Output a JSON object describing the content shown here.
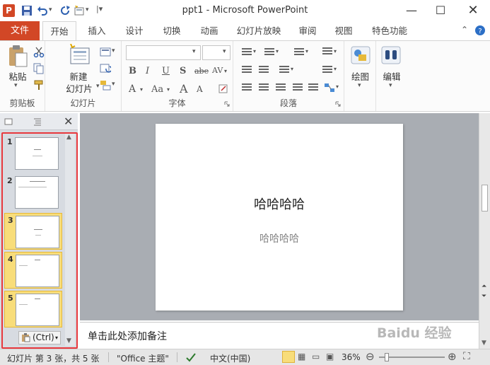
{
  "window": {
    "title": "ppt1 - Microsoft PowerPoint",
    "app_logo": "P",
    "controls": [
      "minimize-icon",
      "maximize-icon",
      "close-icon"
    ]
  },
  "quick_access": [
    "save-icon",
    "undo-icon",
    "redo-icon",
    "new-slide-icon",
    "customize-icon"
  ],
  "ribbon": {
    "file_tab": "文件",
    "tabs": [
      "开始",
      "插入",
      "设计",
      "切换",
      "动画",
      "幻灯片放映",
      "审阅",
      "视图",
      "特色功能"
    ],
    "active_tab": "开始",
    "groups": {
      "clipboard": {
        "label": "剪贴板",
        "paste": "粘贴"
      },
      "slides": {
        "label": "幻灯片",
        "new_slide_line1": "新建",
        "new_slide_line2": "幻灯片"
      },
      "font": {
        "label": "字体",
        "font_name": "",
        "font_size": "",
        "buttons": [
          "B",
          "I",
          "U",
          "S",
          "abe",
          "AV",
          "A",
          "Aa",
          "A",
          "A"
        ]
      },
      "paragraph": {
        "label": "段落"
      },
      "drawing": {
        "label": "绘图"
      },
      "editing": {
        "label": "编辑"
      }
    },
    "accent": "#d24726"
  },
  "slide_pane": {
    "thumbnails": [
      {
        "number": "1",
        "selected": false
      },
      {
        "number": "2",
        "selected": false
      },
      {
        "number": "3",
        "selected": true
      },
      {
        "number": "4",
        "selected": true
      },
      {
        "number": "5",
        "selected": true
      }
    ],
    "paste_options": "(Ctrl)",
    "highlight_color": "#e8383d"
  },
  "slide": {
    "title": "哈哈哈哈",
    "subtitle": "哈哈哈哈"
  },
  "notes": {
    "placeholder": "单击此处添加备注"
  },
  "status": {
    "slide_info": "幻灯片 第 3 张，共 5 张",
    "theme": "\"Office 主题\"",
    "language": "中文(中国)",
    "zoom": "36%"
  },
  "watermark": "Baidu 经验"
}
